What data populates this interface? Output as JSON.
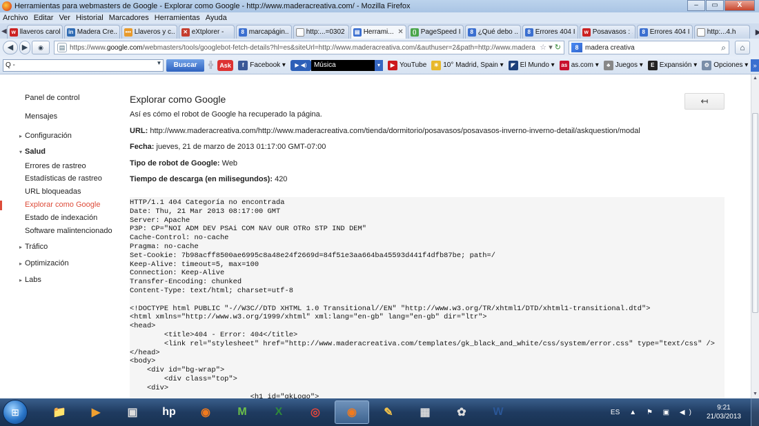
{
  "window": {
    "title": "Herramientas para webmasters de Google - Explorar como Google - http://www.maderacreativa.com/ - Mozilla Firefox",
    "controls": [
      "‒",
      "▭",
      "X"
    ]
  },
  "menu": [
    "Archivo",
    "Editar",
    "Ver",
    "Historial",
    "Marcadores",
    "Herramientas",
    "Ayuda"
  ],
  "tabs": [
    {
      "label": "llaveros carol",
      "color": "#cc2222",
      "glyph": "w"
    },
    {
      "label": "Madera Cre...",
      "color": "#2f6bb3",
      "glyph": "in"
    },
    {
      "label": "Llaveros y c...",
      "color": "#e89a2b",
      "glyph": "•••"
    },
    {
      "label": "eXtplorer -",
      "color": "#c53d2e",
      "glyph": "✕"
    },
    {
      "label": "marcapágin...",
      "color": "#3b6fd0",
      "glyph": "8"
    },
    {
      "label": "http:...=0302",
      "color": "#ffffff",
      "glyph": ""
    },
    {
      "label": "Herrami...",
      "color": "#3b6fd0",
      "glyph": "▤",
      "active": true
    },
    {
      "label": "PageSpeed I...",
      "color": "#4aa54a",
      "glyph": "()"
    },
    {
      "label": "¿Qué debo ...",
      "color": "#3b6fd0",
      "glyph": "8"
    },
    {
      "label": "Errores 404 I...",
      "color": "#3b6fd0",
      "glyph": "8"
    },
    {
      "label": "Posavasos : ...",
      "color": "#cc2222",
      "glyph": "w"
    },
    {
      "label": "Errores 404 I...",
      "color": "#3b6fd0",
      "glyph": "8"
    },
    {
      "label": "http:...4.h",
      "color": "#ffffff",
      "glyph": ""
    }
  ],
  "nav": {
    "url_prefix": "https://www.",
    "url_domain": "google.com",
    "url_rest": "/webmasters/tools/googlebot-fetch-details?hl=es&siteUrl=http://www.maderacreativa.com/&authuser=2&path=http://www.madera",
    "search_value": "madera creativa"
  },
  "toolbar": {
    "search_placeholder": "Q -",
    "buscar_label": "Buscar",
    "ask_label": "Ask",
    "bookmarks": [
      {
        "label": "Facebook ▾",
        "color": "#3b5998",
        "glyph": "f"
      },
      {
        "label": "YouTube",
        "color": "#cc181e",
        "glyph": "▶"
      },
      {
        "label": "10° Madrid, Spain ▾",
        "color": "#e8b82b",
        "glyph": "☀"
      },
      {
        "label": "El Mundo ▾",
        "color": "#1d3f7a",
        "glyph": "◤"
      },
      {
        "label": "as.com ▾",
        "color": "#c8102e",
        "glyph": "as"
      },
      {
        "label": "Juegos ▾",
        "color": "#888888",
        "glyph": "♣"
      },
      {
        "label": "Expansión ▾",
        "color": "#222222",
        "glyph": "E"
      },
      {
        "label": "Opciones ▾",
        "color": "#7a8ea8",
        "glyph": "⚙"
      }
    ],
    "musica_label": "Música"
  },
  "sidebar": {
    "items": [
      {
        "label": "Panel de control",
        "type": "top"
      },
      {
        "label": "Mensajes",
        "type": "top"
      },
      {
        "label": "Configuración",
        "type": "collapsed"
      },
      {
        "label": "Salud",
        "type": "expanded"
      },
      {
        "label": "Errores de rastreo",
        "type": "sub"
      },
      {
        "label": "Estadísticas de rastreo",
        "type": "sub"
      },
      {
        "label": "URL bloqueadas",
        "type": "sub"
      },
      {
        "label": "Explorar como Google",
        "type": "sub",
        "active": true
      },
      {
        "label": "Estado de indexación",
        "type": "sub"
      },
      {
        "label": "Software malintencionado",
        "type": "sub"
      },
      {
        "label": "Tráfico",
        "type": "collapsed"
      },
      {
        "label": "Optimización",
        "type": "collapsed"
      },
      {
        "label": "Labs",
        "type": "collapsed"
      }
    ]
  },
  "main": {
    "title": "Explorar como Google",
    "back_label": "↤",
    "intro": "Así es cómo el robot de Google ha recuperado la página.",
    "url_label": "URL:",
    "url_value": " http://www.maderacreativa.com/http://www.maderacreativa.com/tienda/dormitorio/posavasos/posavasos-inverno-inverno-detail/askquestion/modal",
    "fecha_label": "Fecha:",
    "fecha_value": " jueves, 21 de marzo de 2013 01:17:00 GMT-07:00",
    "robot_label": "Tipo de robot de Google:",
    "robot_value": " Web",
    "tiempo_label": "Tiempo de descarga (en milisegundos):",
    "tiempo_value": " 420",
    "code": "HTTP/1.1 404 Categoría no encontrada\nDate: Thu, 21 Mar 2013 08:17:00 GMT\nServer: Apache\nP3P: CP=\"NOI ADM DEV PSAi COM NAV OUR OTRo STP IND DEM\"\nCache-Control: no-cache\nPragma: no-cache\nSet-Cookie: 7b98acff8500ae6995c8a48e24f2669d=84f51e3aa664ba45593d441f4dfb87be; path=/\nKeep-Alive: timeout=5, max=100\nConnection: Keep-Alive\nTransfer-Encoding: chunked\nContent-Type: text/html; charset=utf-8\n\n<!DOCTYPE html PUBLIC \"-//W3C//DTD XHTML 1.0 Transitional//EN\" \"http://www.w3.org/TR/xhtml1/DTD/xhtml1-transitional.dtd\">\n<html xmlns=\"http://www.w3.org/1999/xhtml\" xml:lang=\"en-gb\" lang=\"en-gb\" dir=\"ltr\">\n<head>\n        <title>404 - Error: 404</title>\n        <link rel=\"stylesheet\" href=\"http://www.maderacreativa.com/templates/gk_black_and_white/css/system/error.css\" type=\"text/css\" />\n</head>\n<body>\n    <div id=\"bg-wrap\">\n        <div class=\"top\">\n    <div>\n                            <h1 id=\"gkLogo\">"
  },
  "taskbar": {
    "apps": [
      {
        "name": "explorer",
        "glyph": "📁",
        "color": "#f3d27a"
      },
      {
        "name": "media-player",
        "glyph": "▶",
        "color": "#f0a030"
      },
      {
        "name": "devices",
        "glyph": "▣",
        "color": "#dddddd"
      },
      {
        "name": "hp",
        "glyph": "hp",
        "color": "#ffffff"
      },
      {
        "name": "firefox",
        "glyph": "◉",
        "color": "#f07a1e"
      },
      {
        "name": "movistar",
        "glyph": "M",
        "color": "#6cc04a"
      },
      {
        "name": "excel",
        "glyph": "X",
        "color": "#2e8b3a"
      },
      {
        "name": "chrome",
        "glyph": "◎",
        "color": "#e4463b"
      },
      {
        "name": "firefox-active",
        "glyph": "◉",
        "color": "#f07a1e",
        "hl": true
      },
      {
        "name": "notes",
        "glyph": "✎",
        "color": "#f3c24a"
      },
      {
        "name": "calendar",
        "glyph": "▦",
        "color": "#dddddd"
      },
      {
        "name": "paint",
        "glyph": "✿",
        "color": "#dddddd"
      },
      {
        "name": "word",
        "glyph": "W",
        "color": "#2b5797"
      }
    ],
    "lang": "ES",
    "time": "9:21",
    "date": "21/03/2013"
  }
}
